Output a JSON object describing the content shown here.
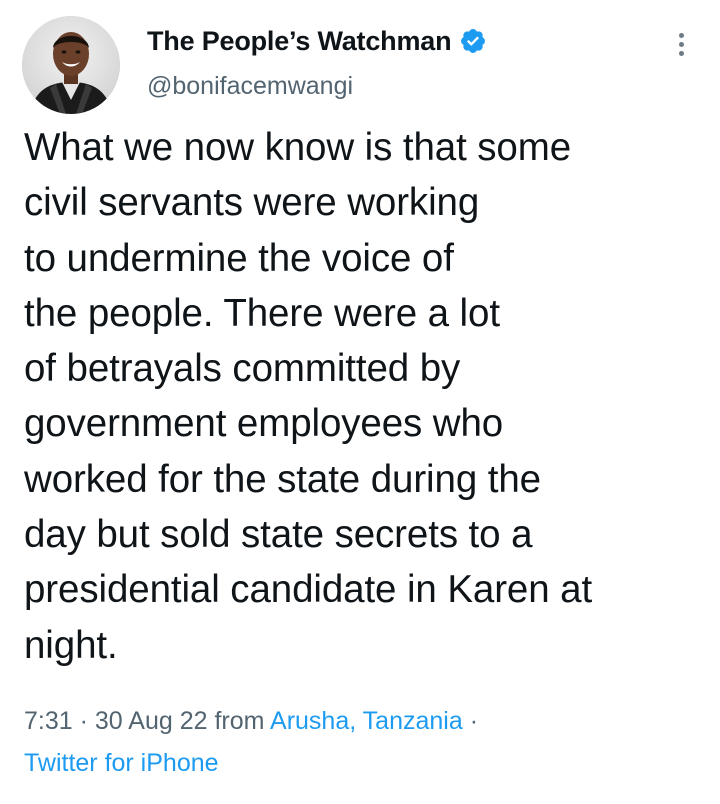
{
  "author": {
    "display_name": "The People’s Watchman",
    "handle": "@bonifacemwangi",
    "verified_icon": "verified-badge-icon",
    "avatar": "profile-photo"
  },
  "more_icon": "more-vertical-icon",
  "tweet": {
    "lines": [
      "What we now know is that some",
      "civil servants were working",
      "to undermine the voice of",
      "the people. There were a lot",
      "of betrayals committed by",
      "government employees who",
      "worked for the state during the",
      "day but sold state secrets to a",
      "presidential candidate in Karen at",
      "night."
    ]
  },
  "meta": {
    "time": "7:31",
    "separator_1": " · ",
    "date": "30 Aug 22",
    "from_label": " from ",
    "location": "Arusha, Tanzania",
    "separator_2": " ·",
    "source": "Twitter for iPhone"
  },
  "colors": {
    "text": "#0f1419",
    "secondary": "#536471",
    "link": "#1d9bf0",
    "verified": "#1d9bf0"
  }
}
